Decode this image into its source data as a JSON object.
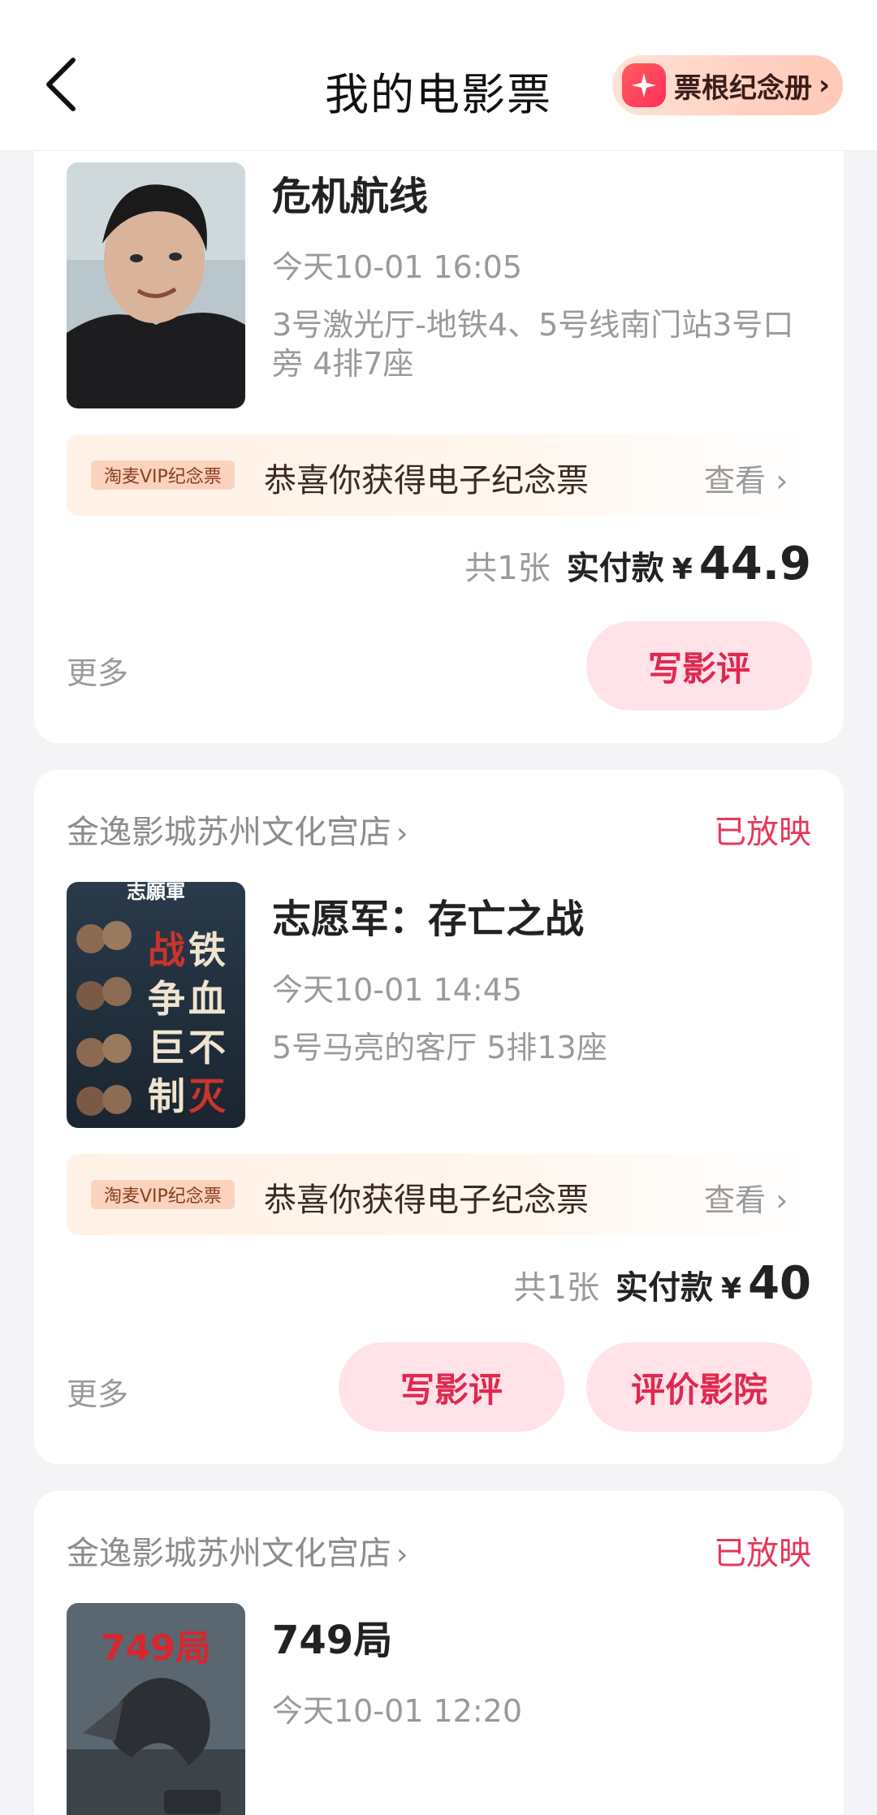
{
  "header": {
    "title": "我的电影票",
    "stub_button": "票根纪念册"
  },
  "orders": [
    {
      "movie_title": "危机航线",
      "showtime": "今天10-01 16:05",
      "seat": "3号激光厅-地铁4、5号线南门站3号口旁 4排7座",
      "souvenir_badge": "淘麦VIP纪念票",
      "souvenir_text": "恭喜你获得电子纪念票",
      "souvenir_view": "查看",
      "count": "共1张",
      "paid_label": "实付款",
      "currency": "¥",
      "amount": "44.9",
      "more": "更多",
      "buttons": [
        "写影评"
      ]
    },
    {
      "cinema": "金逸影城苏州文化宫店",
      "status": "已放映",
      "movie_title": "志愿军：存亡之战",
      "showtime": "今天10-01 14:45",
      "seat": "5号马亮的客厅 5排13座",
      "poster_text": [
        "志願軍",
        "铁血不灭",
        "战争巨制"
      ],
      "souvenir_badge": "淘麦VIP纪念票",
      "souvenir_text": "恭喜你获得电子纪念票",
      "souvenir_view": "查看",
      "count": "共1张",
      "paid_label": "实付款",
      "currency": "¥",
      "amount": "40",
      "more": "更多",
      "buttons": [
        "写影评",
        "评价影院"
      ]
    },
    {
      "cinema": "金逸影城苏州文化宫店",
      "status": "已放映",
      "movie_title": "749局",
      "showtime": "今天10-01 12:20",
      "poster_text": [
        "749局"
      ]
    }
  ],
  "colors": {
    "accent": "#e8375a",
    "button_bg": "#ffe3e9",
    "page_bg": "#f4f4f6"
  }
}
